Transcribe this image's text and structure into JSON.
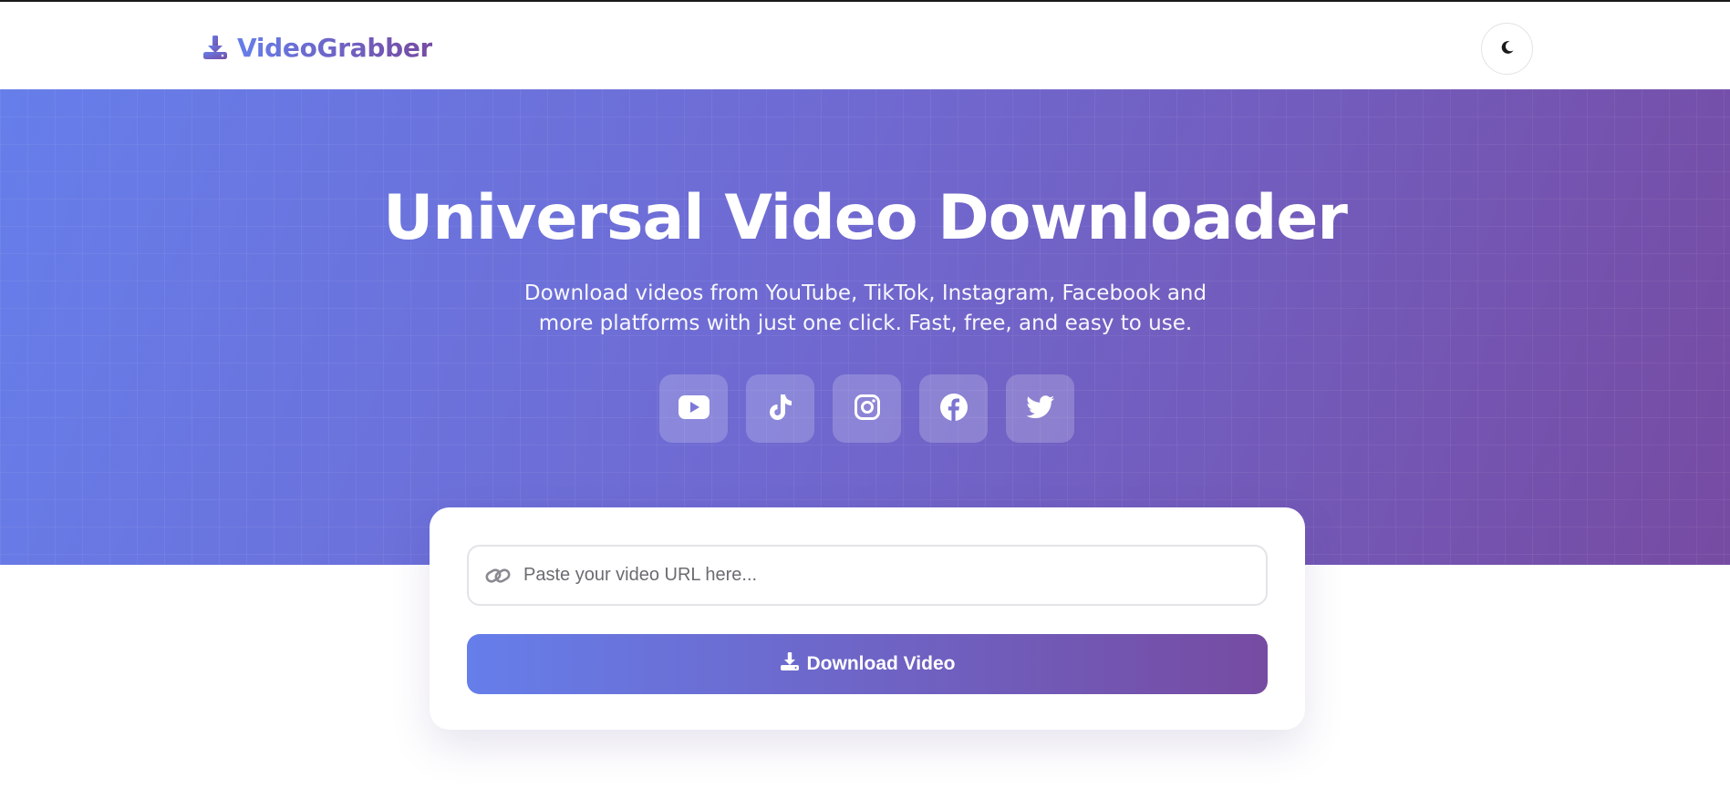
{
  "brand": {
    "name": "VideoGrabber",
    "icon": "download-icon"
  },
  "header": {
    "theme_toggle_icon": "moon-icon"
  },
  "hero": {
    "title": "Universal Video Downloader",
    "subtitle": "Download videos from YouTube, TikTok, Instagram, Facebook and more platforms with just one click. Fast, free, and easy to use.",
    "platforms": [
      {
        "icon": "youtube-icon"
      },
      {
        "icon": "tiktok-icon"
      },
      {
        "icon": "instagram-icon"
      },
      {
        "icon": "facebook-icon"
      },
      {
        "icon": "twitter-icon"
      }
    ]
  },
  "form": {
    "url_placeholder": "Paste your video URL here...",
    "url_value": "",
    "url_icon": "link-icon",
    "download_label": "Download Video",
    "download_icon": "download-icon"
  },
  "colors": {
    "gradient_start": "#667eea",
    "gradient_end": "#764ba2"
  }
}
